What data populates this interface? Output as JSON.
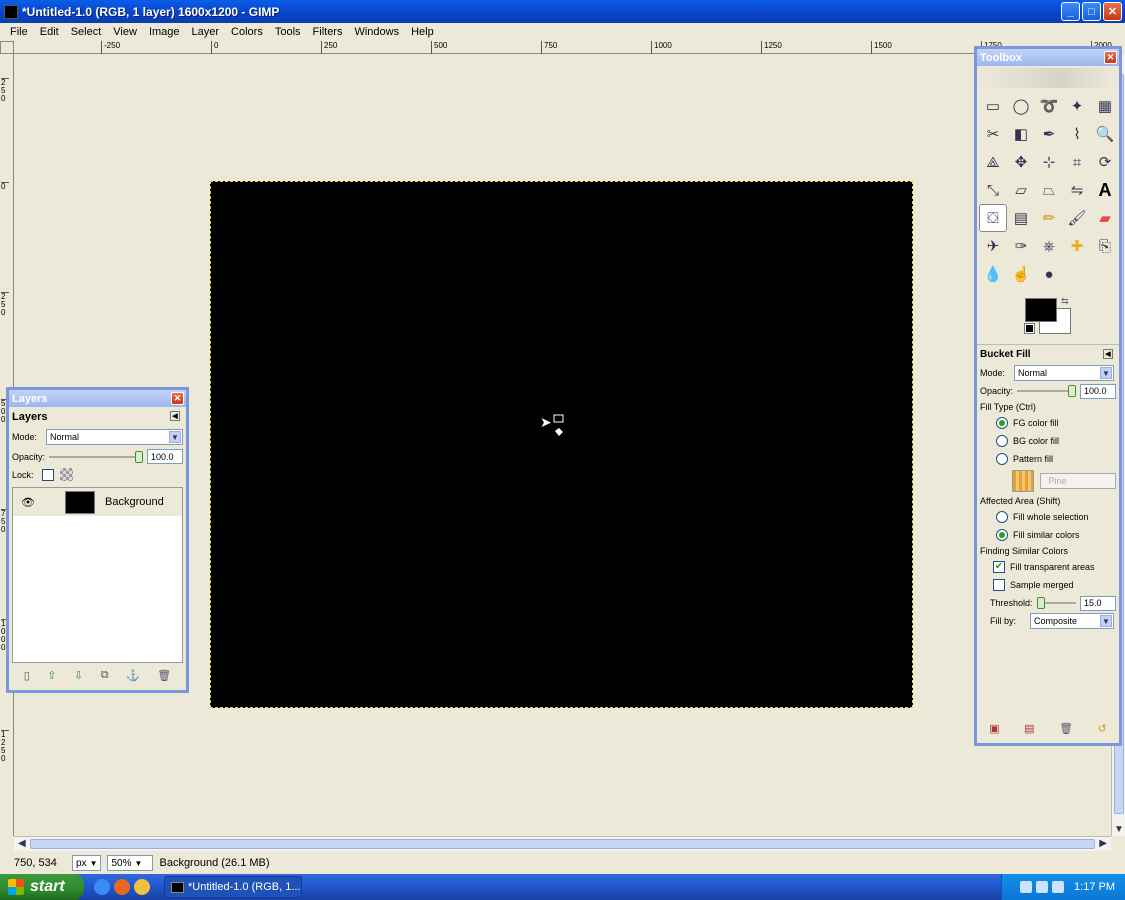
{
  "window": {
    "title": "*Untitled-1.0 (RGB, 1 layer) 1600x1200 - GIMP",
    "buttons": {
      "minimize": "_",
      "maximize": "□",
      "close": "✕"
    }
  },
  "menu": [
    "File",
    "Edit",
    "Select",
    "View",
    "Image",
    "Layer",
    "Colors",
    "Tools",
    "Filters",
    "Windows",
    "Help"
  ],
  "ruler": {
    "top": [
      "-250",
      "0",
      "250",
      "500",
      "750",
      "1000",
      "1250",
      "1500",
      "1750",
      "2000"
    ],
    "left": [
      "250",
      "0",
      "250",
      "500",
      "750",
      "1000",
      "1250"
    ]
  },
  "status": {
    "coords": "750, 534",
    "unit": "px",
    "zoom": "50%",
    "info": "Background (26.1 MB)"
  },
  "taskbar": {
    "start": "start",
    "task_label": "*Untitled-1.0 (RGB, 1...",
    "clock": "1:17 PM"
  },
  "layers_dialog": {
    "title": "Layers",
    "header": "Layers",
    "mode_label": "Mode:",
    "mode_value": "Normal",
    "opacity_label": "Opacity:",
    "opacity_value": "100.0",
    "lock_label": "Lock:",
    "layer_name": "Background"
  },
  "toolbox": {
    "title": "Toolbox",
    "options_title": "Bucket Fill",
    "mode_label": "Mode:",
    "mode_value": "Normal",
    "opacity_label": "Opacity:",
    "opacity_value": "100.0",
    "fill_type_label": "Fill Type  (Ctrl)",
    "fill_fg": "FG color fill",
    "fill_bg": "BG color fill",
    "fill_pattern": "Pattern fill",
    "pattern_name": "Pine",
    "affected_label": "Affected Area  (Shift)",
    "fill_whole": "Fill whole selection",
    "fill_similar": "Fill similar colors",
    "finding_label": "Finding Similar Colors",
    "fill_transparent": "Fill transparent areas",
    "sample_merged": "Sample merged",
    "threshold_label": "Threshold:",
    "threshold_value": "15.0",
    "fillby_label": "Fill by:",
    "fillby_value": "Composite"
  }
}
